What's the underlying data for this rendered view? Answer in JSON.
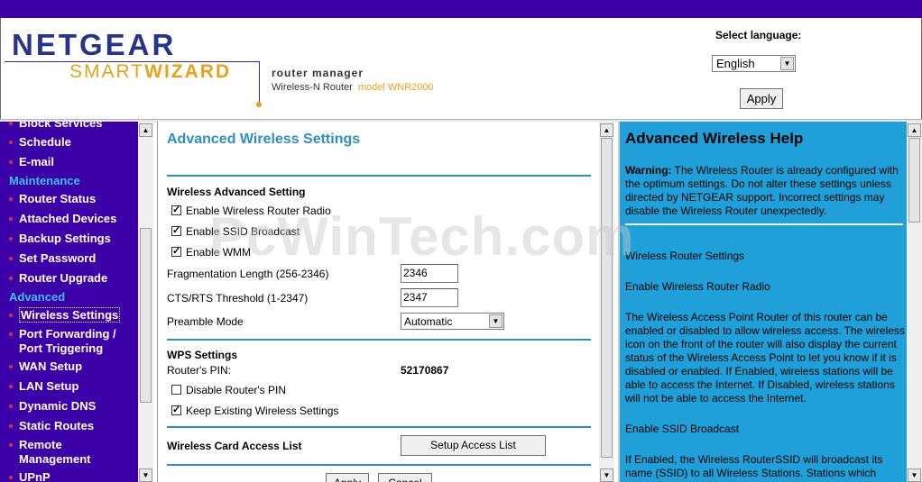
{
  "header": {
    "brand": "NETGEAR",
    "smart": "SMART",
    "wizard": "WIZARD",
    "product_title": "router manager",
    "product_sub": "Wireless-N Router",
    "model": "model WNR2000",
    "lang_label": "Select language:",
    "lang_value": "English",
    "apply_label": "Apply"
  },
  "nav": {
    "cut_item": "Block Services",
    "items_top": [
      "Schedule",
      "E-mail"
    ],
    "maintenance_heading": "Maintenance",
    "maintenance_items": [
      "Router Status",
      "Attached Devices",
      "Backup Settings",
      "Set Password",
      "Router Upgrade"
    ],
    "advanced_heading": "Advanced",
    "advanced_items": [
      "Wireless Settings",
      "Port Forwarding /",
      "Port Triggering",
      "WAN Setup",
      "LAN Setup",
      "Dynamic DNS",
      "Static Routes",
      "Remote",
      "Management",
      "UPnP"
    ]
  },
  "main": {
    "title": "Advanced Wireless Settings",
    "section1": "Wireless Advanced Setting",
    "cb_radio": "Enable Wireless Router Radio",
    "cb_ssid": "Enable SSID Broadcast",
    "cb_wmm": "Enable WMM",
    "frag_label": "Fragmentation Length (256-2346)",
    "frag_value": "2346",
    "cts_label": "CTS/RTS Threshold (1-2347)",
    "cts_value": "2347",
    "preamble_label": "Preamble Mode",
    "preamble_value": "Automatic",
    "wps_title": "WPS Settings",
    "pin_label": "Router's PIN:",
    "pin_value": "52170867",
    "cb_disable_pin": "Disable Router's PIN",
    "cb_keep": "Keep Existing Wireless Settings",
    "acl_label": "Wireless Card Access List",
    "acl_button": "Setup Access List",
    "apply_button": "Apply",
    "cancel_button": "Cancel",
    "checkbox_states": {
      "radio": true,
      "ssid": true,
      "wmm": true,
      "disable_pin": false,
      "keep": true
    }
  },
  "help": {
    "title": "Advanced Wireless Help",
    "warning_bold": "Warning:",
    "warning_text": " The Wireless Router is already configured with the optimum settings. Do not alter these settings unless directed by NETGEAR support. Incorrect settings may disable the Wireless Router unexpectedly.",
    "h1": "Wireless Router Settings",
    "h2": "Enable Wireless Router Radio",
    "p1": "The Wireless Access Point Router of this router can be enabled or disabled to allow wireless access. The wireless icon on the front of the router will also display the current status of the Wireless Access Point to let you know if it is disabled or enabled. If Enabled, wireless stations will be able to access the Internet. If Disabled, wireless stations will not be able to access the Internet.",
    "h3": "Enable SSID Broadcast",
    "p2": "If Enabled, the Wireless RouterSSID will broadcast its name (SSID) to all Wireless Stations. Stations which"
  },
  "watermark": "PcWinTech.com",
  "colors": {
    "nav_bg": "#3b00a8",
    "accent_blue": "#2c8fc6",
    "help_bg": "#1fa0d8",
    "nav_heading": "#3cc0f0",
    "bullet": "#e03030"
  }
}
